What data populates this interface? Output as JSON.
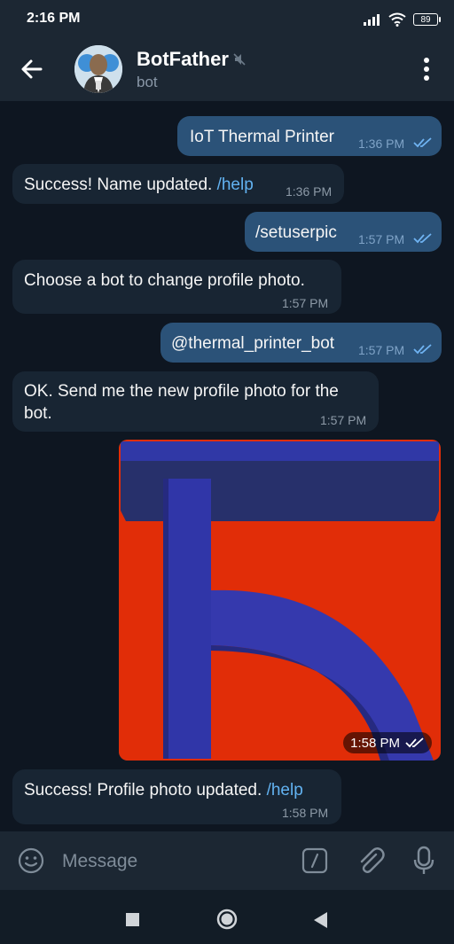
{
  "status_bar": {
    "time": "2:16 PM",
    "battery": "89"
  },
  "header": {
    "title": "BotFather",
    "subtitle": "bot"
  },
  "messages": [
    {
      "dir": "out",
      "text": "IoT Thermal Printer",
      "time": "1:36 PM"
    },
    {
      "dir": "in",
      "text": "Success! Name updated.",
      "link": "/help",
      "time": "1:36 PM"
    },
    {
      "dir": "out",
      "text": "/setuserpic",
      "time": "1:57 PM"
    },
    {
      "dir": "in",
      "text": "Choose a bot to change profile photo.",
      "time": "1:57 PM"
    },
    {
      "dir": "out",
      "text": "@thermal_printer_bot",
      "time": "1:57 PM"
    },
    {
      "dir": "in",
      "line1": "OK. Send me the new profile photo for the",
      "line2": "bot.",
      "time": "1:57 PM"
    },
    {
      "dir": "out",
      "type": "photo",
      "time": "1:58 PM"
    },
    {
      "dir": "in",
      "text": "Success! Profile photo updated.",
      "link": "/help",
      "time": "1:58 PM"
    }
  ],
  "composer": {
    "placeholder": "Message"
  },
  "colors": {
    "background": "#0e1621",
    "bar": "#1c2733",
    "incoming_bubble": "#182533",
    "outgoing_bubble": "#2b5278",
    "link": "#62b2f1",
    "photo_red": "#e12d08",
    "photo_blue": "#2f33a0"
  },
  "icons": [
    "back-arrow-icon",
    "mute-icon",
    "more-vertical-icon",
    "double-check-icon",
    "emoji-icon",
    "bot-command-icon",
    "paperclip-icon",
    "microphone-icon"
  ]
}
